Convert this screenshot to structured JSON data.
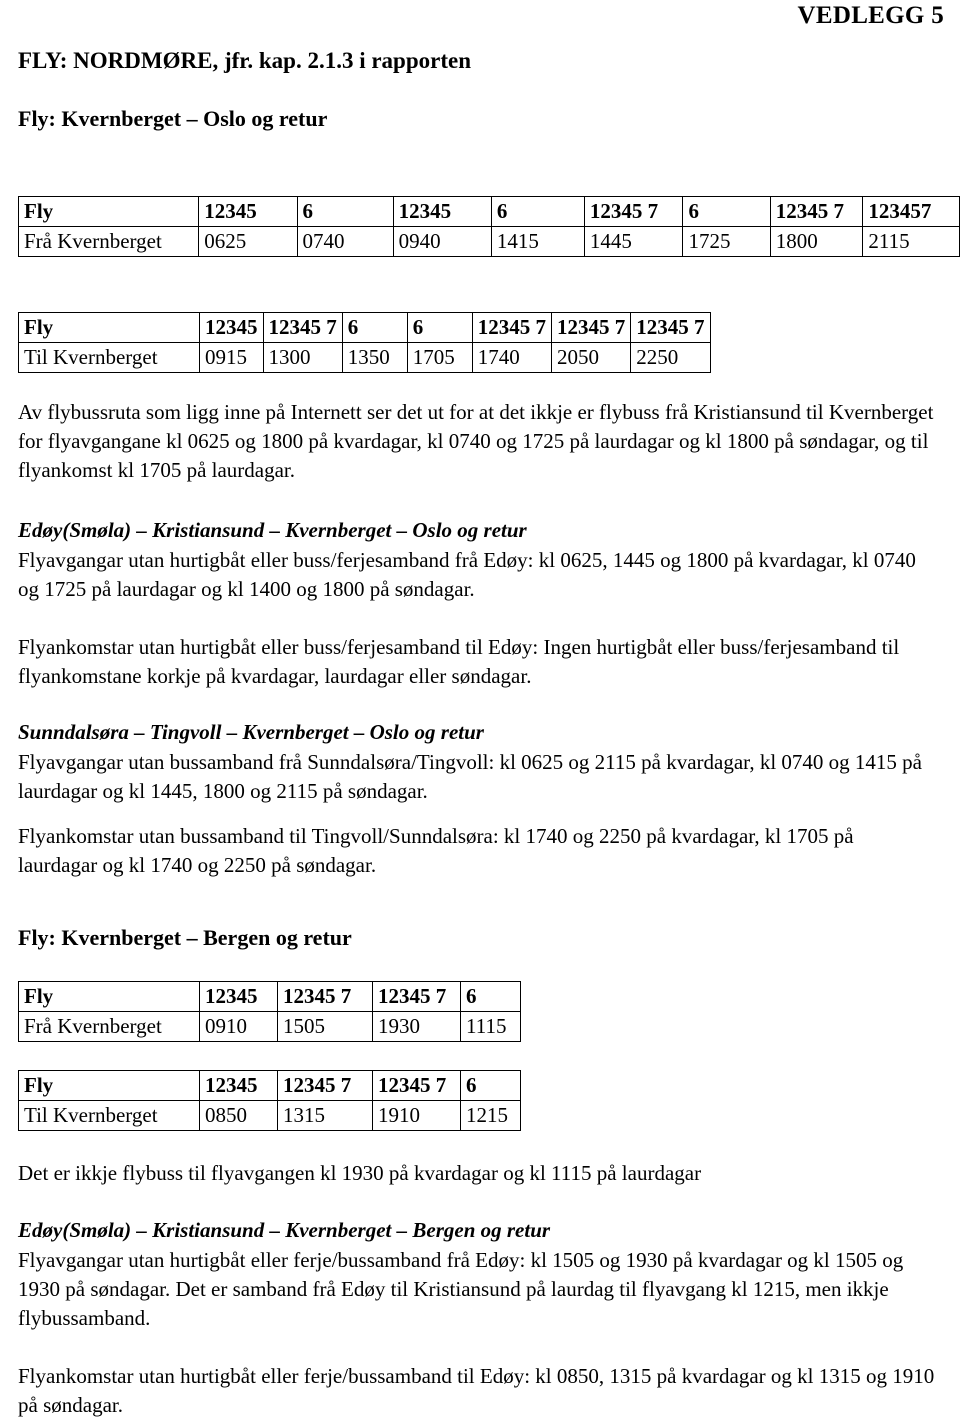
{
  "header": {
    "vedlegg": "VEDLEGG 5",
    "title": "FLY: NORDMØRE, jfr. kap. 2.1.3 i rapporten"
  },
  "sections": {
    "oslo_heading": "Fly: Kvernberget – Oslo og retur",
    "bergen_heading": "Fly: Kvernberget – Bergen og retur",
    "edoy_oslo_heading": "Edøy(Smøla) – Kristiansund – Kvernberget – Oslo og retur",
    "sunndalsora_heading": "Sunndalsøra – Tingvoll – Kvernberget – Oslo og retur",
    "edoy_bergen_heading": "Edøy(Smøla) – Kristiansund – Kvernberget – Bergen og retur"
  },
  "table_avganger_oslo": {
    "row_header_label": "Fly",
    "row_data_label": "Frå Kvernberget",
    "days": [
      "12345",
      "6",
      "12345",
      "6",
      "12345 7",
      "6",
      "12345 7",
      "123457"
    ],
    "times": [
      "0625",
      "0740",
      "0940",
      "1415",
      "1445",
      "1725",
      "1800",
      "2115"
    ]
  },
  "table_ankomst_oslo": {
    "row_header_label": "Fly",
    "row_data_label": "Til Kvernberget",
    "days": [
      "12345",
      "12345 7",
      "6",
      "6",
      "12345 7",
      "12345 7",
      "12345 7"
    ],
    "times": [
      "0915",
      "1300",
      "1350",
      "1705",
      "1740",
      "2050",
      "2250"
    ]
  },
  "table_avganger_bergen": {
    "row_header_label": "Fly",
    "row_data_label": "Frå Kvernberget",
    "days": [
      "12345",
      "12345 7",
      "12345 7",
      "6"
    ],
    "times": [
      "0910",
      "1505",
      "1930",
      "1115"
    ]
  },
  "table_ankomst_bergen": {
    "row_header_label": "Fly",
    "row_data_label": "Til Kvernberget",
    "days": [
      "12345",
      "12345 7",
      "12345 7",
      "6"
    ],
    "times": [
      "0850",
      "1315",
      "1910",
      "1215"
    ]
  },
  "paragraphs": {
    "flybuss_oslo": "Av flybussruta som ligg inne på Internett ser det ut for at det ikkje er flybuss frå Kristiansund til Kvernberget for flyavgangane kl 0625 og 1800 på kvardagar, kl 0740 og 1725 på laurdagar og kl 1800 på søndagar, og til flyankomst kl 1705 på laurdagar.",
    "edoy_oslo_avgang": "Flyavgangar utan hurtigbåt eller buss/ferjesamband frå Edøy:  kl 0625, 1445 og 1800 på kvardagar, kl 0740 og 1725 på laurdagar og kl 1400 og 1800 på søndagar.",
    "edoy_oslo_ankomst": "Flyankomstar utan hurtigbåt eller buss/ferjesamband til Edøy: Ingen hurtigbåt eller buss/ferjesamband til flyankomstane korkje på kvardagar, laurdagar eller søndagar.",
    "sunndalsora_avgang": "Flyavgangar utan bussamband frå Sunndalsøra/Tingvoll: kl 0625 og 2115 på kvardagar, kl 0740 og 1415 på laurdagar og kl 1445, 1800 og 2115 på søndagar.",
    "sunndalsora_ankomst": "Flyankomstar utan bussamband til Tingvoll/Sunndalsøra: kl 1740 og 2250 på kvardagar, kl 1705 på laurdagar og kl 1740 og 2250 på søndagar.",
    "bergen_flybuss": "Det er ikkje flybuss til flyavgangen kl 1930 på kvardagar og kl 1115 på laurdagar",
    "edoy_bergen_avgang": "Flyavgangar utan hurtigbåt eller ferje/bussamband frå Edøy:  kl 1505 og 1930 på kvardagar og kl 1505 og 1930 på søndagar. Det er samband frå Edøy til Kristiansund på laurdag til flyavgang kl 1215, men ikkje flybussamband.",
    "edoy_bergen_ankomst": "Flyankomstar utan hurtigbåt eller ferje/bussamband til Edøy: kl 0850, 1315 på kvardagar og kl 1315 og 1910 på søndagar."
  }
}
